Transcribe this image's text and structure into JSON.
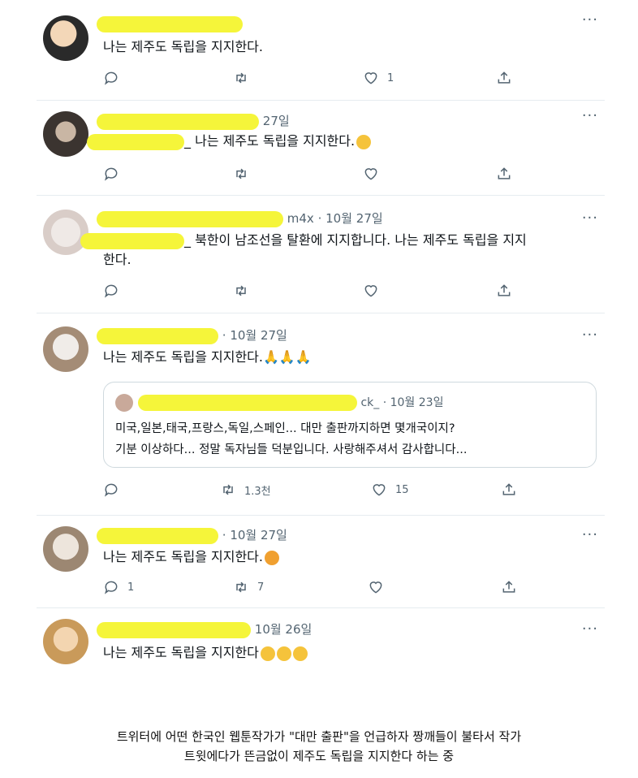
{
  "colors": {
    "highlight": "#f5f53a",
    "icon": "#536471",
    "text": "#0f1419",
    "divider": "#e6ecf0"
  },
  "tweets": [
    {
      "header_suffix": "",
      "text": "나는 제주도 독립을 지지한다.",
      "reply": "",
      "retweet": "",
      "like": "1"
    },
    {
      "header_suffix": "27일",
      "text_prefix": "_",
      "text": "나는 제주도 독립을 지지한다.",
      "reply": "",
      "retweet": "",
      "like": ""
    },
    {
      "header_suffix": "m4x · 10월 27일",
      "text_prefix": "_",
      "text_line1": "북한이 남조선을 탈환에 지지합니다. 나는 제주도 독립을 지지",
      "text_line2": "한다.",
      "reply": "",
      "retweet": "",
      "like": ""
    },
    {
      "header_suffix": "· 10월 27일",
      "text": "나는 제주도 독립을 지지한다.🙏🙏🙏",
      "quote": {
        "header_suffix": "ck_ · 10월 23일",
        "line1": "미국,일본,태국,프랑스,독일,스페인... 대만 출판까지하면 몇개국이지?",
        "line2": "기분 이상하다... 정말 독자님들 덕분입니다. 사랑해주셔서 감사합니다..."
      },
      "reply": "",
      "retweet": "1.3천",
      "like": "15"
    },
    {
      "header_suffix": "· 10월 27일",
      "text": "나는 제주도 독립을 지지한다.",
      "reply": "1",
      "retweet": "7",
      "like": ""
    },
    {
      "header_suffix": "10월 26일",
      "text": "나는 제주도 독립을 지지한다",
      "reply": "",
      "retweet": "",
      "like": ""
    }
  ],
  "more_label": "···",
  "caption": {
    "line1": "트위터에 어떤 한국인 웹툰작가가 \"대만 출판\"을 언급하자 짱깨들이 불타서 작가",
    "line2": "트윗에다가 뜬금없이 제주도 독립을 지지한다 하는 중"
  }
}
